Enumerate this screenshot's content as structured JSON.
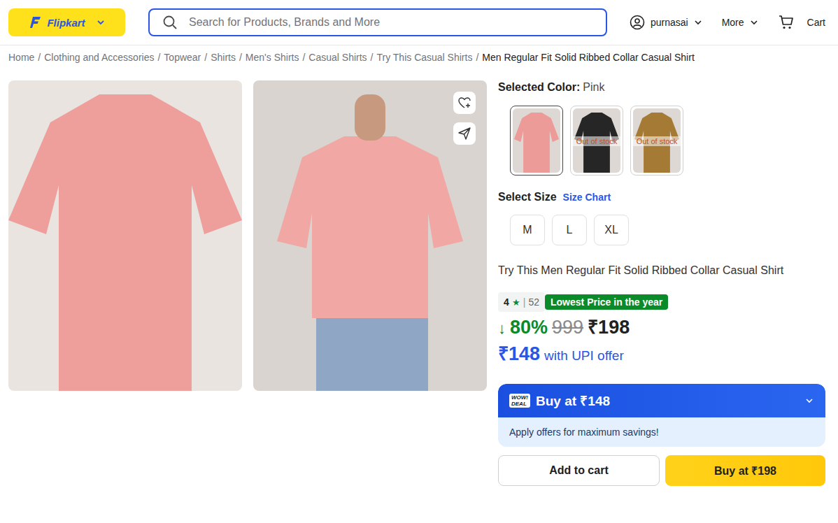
{
  "header": {
    "logo": "Flipkart",
    "search": {
      "placeholder": "Search for Products, Brands and More"
    },
    "account": "purnasai",
    "more": "More",
    "cart": "Cart"
  },
  "breadcrumbs": {
    "separator": "/",
    "items": [
      "Home",
      "Clothing and Accessories",
      "Topwear",
      "Shirts",
      "Men's Shirts",
      "Casual Shirts",
      "Try This Casual Shirts",
      "Men Regular Fit Solid Ribbed Collar Casual Shirt"
    ]
  },
  "gallery": [
    {
      "view": "front",
      "color": "#ee9f9b"
    },
    {
      "view": "back",
      "color": "#f1a7a4"
    }
  ],
  "color_picker": {
    "label": "Selected Color:",
    "value": "Pink",
    "out_of_stock_label": "Out of stock",
    "swatches": [
      {
        "color": "#ec9b98",
        "selected": true,
        "out_of_stock": false
      },
      {
        "color": "#262626",
        "selected": false,
        "out_of_stock": true
      },
      {
        "color": "#a57a34",
        "selected": false,
        "out_of_stock": true
      }
    ]
  },
  "size_picker": {
    "label": "Select Size",
    "chart_link": "Size Chart",
    "sizes": [
      {
        "label": "M",
        "selected": false
      },
      {
        "label": "L",
        "selected": false
      },
      {
        "label": "XL",
        "selected": false
      }
    ]
  },
  "title": "Try This Men Regular Fit Solid Ribbed Collar Casual Shirt",
  "rating": {
    "value": "4",
    "star": "★",
    "divider": "|",
    "count": "52"
  },
  "price_badge": "Lowest Price in the year",
  "price": {
    "arrow": "↓",
    "discount": "80%",
    "mrp": "999",
    "current": "₹198"
  },
  "upi": {
    "price": "₹148",
    "label": "with UPI offer"
  },
  "deal": {
    "badge": [
      "WOW!",
      "DEAL"
    ],
    "label": "Buy at ₹148",
    "note": "Apply offers for maximum savings!"
  },
  "actions": {
    "add_to_cart": "Add to cart",
    "buy": "Buy at ₹198"
  }
}
